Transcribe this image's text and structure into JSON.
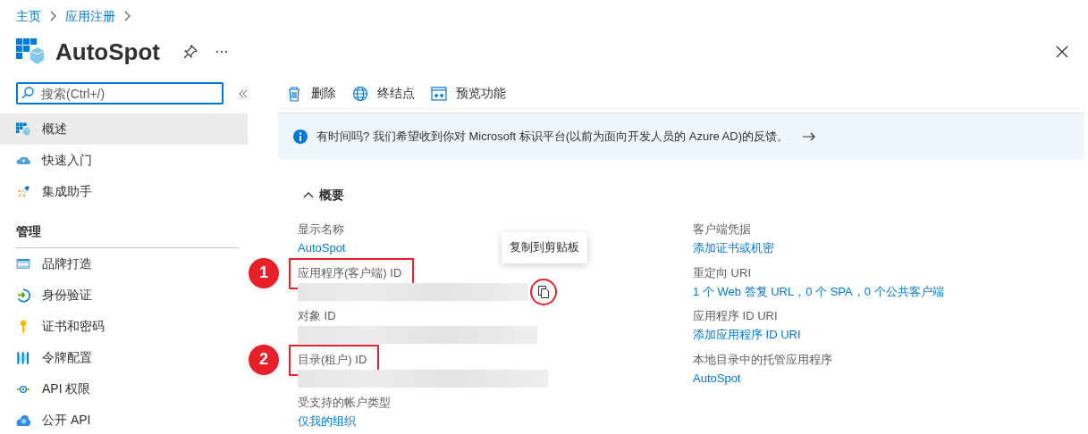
{
  "breadcrumb": [
    {
      "label": "主页"
    },
    {
      "label": "应用注册"
    }
  ],
  "title": "AutoSpot",
  "search": {
    "placeholder": "搜索(Ctrl+/)"
  },
  "sidebar": {
    "groups": [
      {
        "items": [
          {
            "label": "概述",
            "selected": true
          },
          {
            "label": "快速入门",
            "selected": false
          },
          {
            "label": "集成助手",
            "selected": false
          }
        ]
      },
      {
        "heading": "管理",
        "items": [
          {
            "label": "品牌打造",
            "selected": false
          },
          {
            "label": "身份验证",
            "selected": false
          },
          {
            "label": "证书和密码",
            "selected": false
          },
          {
            "label": "令牌配置",
            "selected": false
          },
          {
            "label": "API 权限",
            "selected": false
          },
          {
            "label": "公开 API",
            "selected": false
          }
        ]
      }
    ]
  },
  "toolbar": [
    {
      "label": "删除"
    },
    {
      "label": "终结点"
    },
    {
      "label": "预览功能"
    }
  ],
  "banner": {
    "text": "有时间吗? 我们希望收到你对 Microsoft 标识平台(以前为面向开发人员的 Azure AD)的反馈。"
  },
  "essentials": {
    "heading": "概要",
    "expanded": true,
    "left": [
      {
        "label": "显示名称",
        "kind": "link",
        "value": "AutoSpot"
      },
      {
        "label": "应用程序(客户端) ID",
        "kind": "redacted",
        "annotation": "1",
        "tooltip": "复制到剪贴板"
      },
      {
        "label": "对象 ID",
        "kind": "redacted"
      },
      {
        "label": "目录(租户) ID",
        "kind": "redacted",
        "annotation": "2"
      },
      {
        "label": "受支持的帐户类型",
        "kind": "link",
        "value": "仅我的组织"
      }
    ],
    "right": [
      {
        "label": "客户端凭据",
        "kind": "link",
        "value": "添加证书或机密"
      },
      {
        "label": "重定向 URI",
        "kind": "link",
        "value": "1 个 Web 答复 URL，0 个 SPA，0 个公共客户端"
      },
      {
        "label": "应用程序 ID URI",
        "kind": "link",
        "value": "添加应用程序 ID URI"
      },
      {
        "label": "本地目录中的托管应用程序",
        "kind": "link",
        "value": "AutoSpot"
      }
    ]
  }
}
